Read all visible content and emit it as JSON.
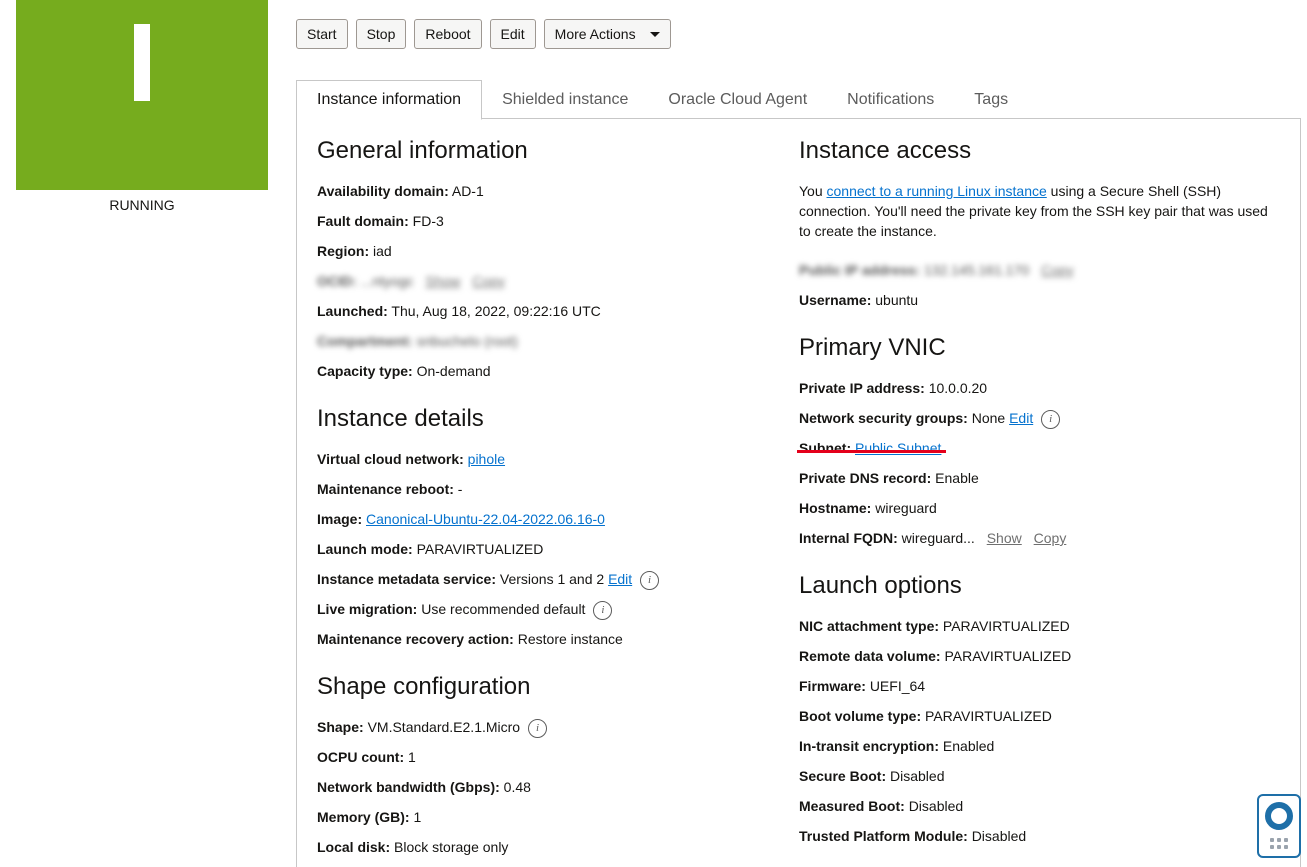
{
  "status": {
    "label": "RUNNING",
    "glyph": "I",
    "color": "#76ac1e"
  },
  "actions": {
    "start": "Start",
    "stop": "Stop",
    "reboot": "Reboot",
    "edit": "Edit",
    "more": "More Actions"
  },
  "tabs": [
    "Instance information",
    "Shielded instance",
    "Oracle Cloud Agent",
    "Notifications",
    "Tags"
  ],
  "general": {
    "title": "General information",
    "availability_domain": {
      "label": "Availability domain:",
      "value": "AD-1"
    },
    "fault_domain": {
      "label": "Fault domain:",
      "value": "FD-3"
    },
    "region": {
      "label": "Region:",
      "value": "iad"
    },
    "ocid": {
      "label": "OCID:",
      "value": "...ntyogc",
      "show": "Show",
      "copy": "Copy"
    },
    "launched": {
      "label": "Launched:",
      "value": "Thu, Aug 18, 2022, 09:22:16 UTC"
    },
    "compartment": {
      "label": "Compartment:",
      "value": "snbuchelo (root)"
    },
    "capacity_type": {
      "label": "Capacity type:",
      "value": "On-demand"
    }
  },
  "details": {
    "title": "Instance details",
    "vcn": {
      "label": "Virtual cloud network:",
      "value": "pihole"
    },
    "maintenance_reboot": {
      "label": "Maintenance reboot:",
      "value": "-"
    },
    "image": {
      "label": "Image:",
      "value": "Canonical-Ubuntu-22.04-2022.06.16-0"
    },
    "launch_mode": {
      "label": "Launch mode:",
      "value": "PARAVIRTUALIZED"
    },
    "metadata_service": {
      "label": "Instance metadata service:",
      "value": "Versions 1 and 2",
      "edit": "Edit"
    },
    "live_migration": {
      "label": "Live migration:",
      "value": "Use recommended default"
    },
    "recovery_action": {
      "label": "Maintenance recovery action:",
      "value": "Restore instance"
    }
  },
  "shape": {
    "title": "Shape configuration",
    "shape": {
      "label": "Shape:",
      "value": "VM.Standard.E2.1.Micro"
    },
    "ocpu": {
      "label": "OCPU count:",
      "value": "1"
    },
    "bandwidth": {
      "label": "Network bandwidth (Gbps):",
      "value": "0.48"
    },
    "memory": {
      "label": "Memory (GB):",
      "value": "1"
    },
    "local_disk": {
      "label": "Local disk:",
      "value": "Block storage only"
    }
  },
  "access": {
    "title": "Instance access",
    "text_before": "You ",
    "link": "connect to a running Linux instance",
    "text_after": " using a Secure Shell (SSH) connection. You'll need the private key from the SSH key pair that was used to create the instance.",
    "public_ip": {
      "label": "Public IP address:",
      "value": "132.145.161.170",
      "copy": "Copy"
    },
    "username": {
      "label": "Username:",
      "value": "ubuntu"
    }
  },
  "vnic": {
    "title": "Primary VNIC",
    "private_ip": {
      "label": "Private IP address:",
      "value": "10.0.0.20"
    },
    "nsg": {
      "label": "Network security groups:",
      "value": "None",
      "edit": "Edit"
    },
    "subnet": {
      "label": "Subnet:",
      "value": "Public Subnet"
    },
    "dns": {
      "label": "Private DNS record:",
      "value": "Enable"
    },
    "hostname": {
      "label": "Hostname:",
      "value": "wireguard"
    },
    "fqdn": {
      "label": "Internal FQDN:",
      "value": "wireguard...",
      "show": "Show",
      "copy": "Copy"
    }
  },
  "launch": {
    "title": "Launch options",
    "nic": {
      "label": "NIC attachment type:",
      "value": "PARAVIRTUALIZED"
    },
    "remote_volume": {
      "label": "Remote data volume:",
      "value": "PARAVIRTUALIZED"
    },
    "firmware": {
      "label": "Firmware:",
      "value": "UEFI_64"
    },
    "boot_volume": {
      "label": "Boot volume type:",
      "value": "PARAVIRTUALIZED"
    },
    "in_transit": {
      "label": "In-transit encryption:",
      "value": "Enabled"
    },
    "secure_boot": {
      "label": "Secure Boot:",
      "value": "Disabled"
    },
    "measured_boot": {
      "label": "Measured Boot:",
      "value": "Disabled"
    },
    "tpm": {
      "label": "Trusted Platform Module:",
      "value": "Disabled"
    }
  },
  "icons": {
    "info": "info-icon",
    "help": "lifebuoy-icon"
  },
  "colors": {
    "link": "#0572ce",
    "highlight": "#e4001b"
  }
}
